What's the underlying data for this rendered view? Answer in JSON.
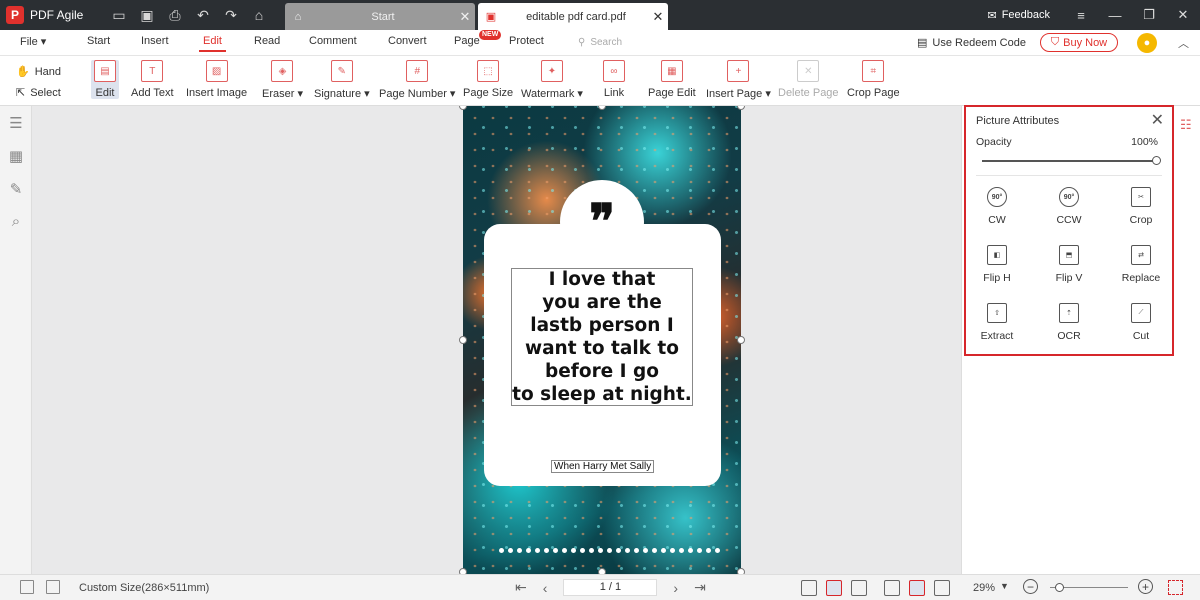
{
  "app": {
    "name": "PDF Agile"
  },
  "tabs": [
    {
      "label": "Start"
    },
    {
      "label": "editable pdf card.pdf"
    }
  ],
  "titlebar": {
    "feedback": "Feedback"
  },
  "menu": {
    "items": [
      "File",
      "Start",
      "Insert",
      "Edit",
      "Read",
      "Comment",
      "Convert",
      "Page",
      "Protect"
    ],
    "active": "Edit",
    "new_badge": "NEW",
    "search_placeholder": "Search",
    "redeem": "Use Redeem Code",
    "buy_now": "Buy Now"
  },
  "ribbon": {
    "hand": "Hand",
    "select": "Select",
    "tools": [
      {
        "label": "Edit"
      },
      {
        "label": "Add Text"
      },
      {
        "label": "Insert Image"
      },
      {
        "label": "Eraser"
      },
      {
        "label": "Signature"
      },
      {
        "label": "Page Number"
      },
      {
        "label": "Page Size"
      },
      {
        "label": "Watermark"
      },
      {
        "label": "Link"
      },
      {
        "label": "Page Edit"
      },
      {
        "label": "Insert Page"
      },
      {
        "label": "Delete Page"
      },
      {
        "label": "Crop Page"
      }
    ]
  },
  "document": {
    "quote": "I love that\nyou are the\nlastb person I\nwant to talk to\nbefore I go\nto sleep at night.",
    "author": "When Harry Met Sally",
    "quote_mark": "❞"
  },
  "picture_attributes": {
    "title": "Picture Attributes",
    "opacity_label": "Opacity",
    "opacity_value": "100%",
    "opacity_fraction": 1.0,
    "actions": [
      {
        "label": "CW",
        "icon": "90°"
      },
      {
        "label": "CCW",
        "icon": "90°"
      },
      {
        "label": "Crop",
        "icon": ""
      },
      {
        "label": "Flip H",
        "icon": ""
      },
      {
        "label": "Flip V",
        "icon": ""
      },
      {
        "label": "Replace",
        "icon": ""
      },
      {
        "label": "Extract",
        "icon": ""
      },
      {
        "label": "OCR",
        "icon": ""
      },
      {
        "label": "Cut",
        "icon": ""
      }
    ]
  },
  "status": {
    "page_size": "Custom Size(286×511mm)",
    "page_indicator": "1 / 1",
    "zoom": "29%"
  },
  "colors": {
    "accent": "#e0312d",
    "highlight_border": "#d6262b"
  }
}
